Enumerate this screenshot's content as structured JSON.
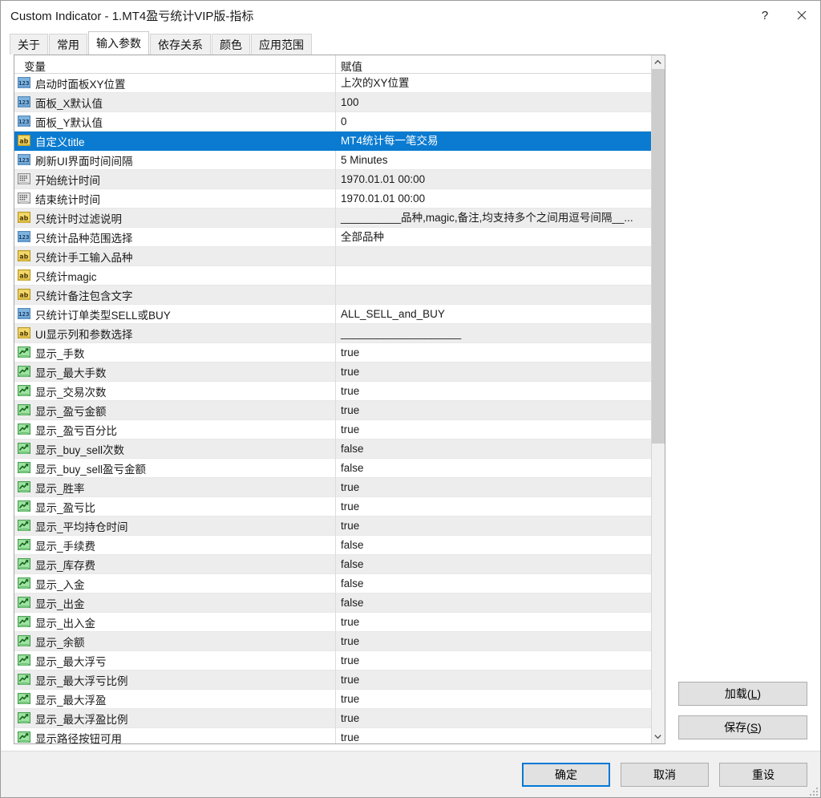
{
  "window": {
    "title": "Custom Indicator - 1.MT4盈亏统计VIP版-指标",
    "help_label": "?",
    "close_label": "✕"
  },
  "tabs": [
    {
      "label": "关于",
      "active": false
    },
    {
      "label": "常用",
      "active": false
    },
    {
      "label": "输入参数",
      "active": true
    },
    {
      "label": "依存关系",
      "active": false
    },
    {
      "label": "颜色",
      "active": false
    },
    {
      "label": "应用范围",
      "active": false
    }
  ],
  "grid": {
    "columns": {
      "name": "变量",
      "value": "赋值"
    },
    "rows": [
      {
        "icon": "number-icon",
        "name": "启动时面板XY位置",
        "value": "上次的XY位置"
      },
      {
        "icon": "number-icon",
        "name": "面板_X默认值",
        "value": "100"
      },
      {
        "icon": "number-icon",
        "name": "面板_Y默认值",
        "value": "0"
      },
      {
        "icon": "string-icon",
        "name": "自定义title",
        "value": "MT4统计每一笔交易",
        "selected": true
      },
      {
        "icon": "number-icon",
        "name": "刷新UI界面时间间隔",
        "value": "5 Minutes"
      },
      {
        "icon": "datetime-icon",
        "name": "开始统计时间",
        "value": "1970.01.01 00:00"
      },
      {
        "icon": "datetime-icon",
        "name": "结束统计时间",
        "value": "1970.01.01 00:00"
      },
      {
        "icon": "string-icon",
        "name": "只统计时过滤说明",
        "value": "__________品种,magic,备注,均支持多个之间用逗号间隔__..."
      },
      {
        "icon": "number-icon",
        "name": "只统计品种范围选择",
        "value": "全部品种"
      },
      {
        "icon": "string-icon",
        "name": "只统计手工输入品种",
        "value": ""
      },
      {
        "icon": "string-icon",
        "name": "只统计magic",
        "value": ""
      },
      {
        "icon": "string-icon",
        "name": "只统计备注包含文字",
        "value": ""
      },
      {
        "icon": "number-icon",
        "name": "只统计订单类型SELL或BUY",
        "value": "ALL_SELL_and_BUY"
      },
      {
        "icon": "string-icon",
        "name": "UI显示列和参数选择",
        "value": "____________________"
      },
      {
        "icon": "bool-icon",
        "name": "显示_手数",
        "value": "true"
      },
      {
        "icon": "bool-icon",
        "name": "显示_最大手数",
        "value": "true"
      },
      {
        "icon": "bool-icon",
        "name": "显示_交易次数",
        "value": "true"
      },
      {
        "icon": "bool-icon",
        "name": "显示_盈亏金额",
        "value": "true"
      },
      {
        "icon": "bool-icon",
        "name": "显示_盈亏百分比",
        "value": "true"
      },
      {
        "icon": "bool-icon",
        "name": "显示_buy_sell次数",
        "value": "false"
      },
      {
        "icon": "bool-icon",
        "name": "显示_buy_sell盈亏金额",
        "value": "false"
      },
      {
        "icon": "bool-icon",
        "name": "显示_胜率",
        "value": "true"
      },
      {
        "icon": "bool-icon",
        "name": "显示_盈亏比",
        "value": "true"
      },
      {
        "icon": "bool-icon",
        "name": "显示_平均持仓时间",
        "value": "true"
      },
      {
        "icon": "bool-icon",
        "name": "显示_手续费",
        "value": "false"
      },
      {
        "icon": "bool-icon",
        "name": "显示_库存费",
        "value": "false"
      },
      {
        "icon": "bool-icon",
        "name": "显示_入金",
        "value": "false"
      },
      {
        "icon": "bool-icon",
        "name": "显示_出金",
        "value": "false"
      },
      {
        "icon": "bool-icon",
        "name": "显示_出入金",
        "value": "true"
      },
      {
        "icon": "bool-icon",
        "name": "显示_余额",
        "value": "true"
      },
      {
        "icon": "bool-icon",
        "name": "显示_最大浮亏",
        "value": "true"
      },
      {
        "icon": "bool-icon",
        "name": "显示_最大浮亏比例",
        "value": "true"
      },
      {
        "icon": "bool-icon",
        "name": "显示_最大浮盈",
        "value": "true"
      },
      {
        "icon": "bool-icon",
        "name": "显示_最大浮盈比例",
        "value": "true"
      },
      {
        "icon": "bool-icon",
        "name": "显示路径按钮可用",
        "value": "true"
      }
    ]
  },
  "side_buttons": [
    {
      "label": "加载(L)",
      "mnemonic": "L",
      "text": "加载("
    },
    {
      "label": "保存(S)",
      "mnemonic": "S",
      "text": "保存("
    }
  ],
  "footer_buttons": [
    {
      "label": "确定",
      "primary": true
    },
    {
      "label": "取消",
      "primary": false
    },
    {
      "label": "重设",
      "primary": false
    }
  ],
  "colors": {
    "selection": "#0a7bd1",
    "accent": "#0078d7",
    "alt_row": "#ededed",
    "button_face": "#e1e1e1"
  }
}
